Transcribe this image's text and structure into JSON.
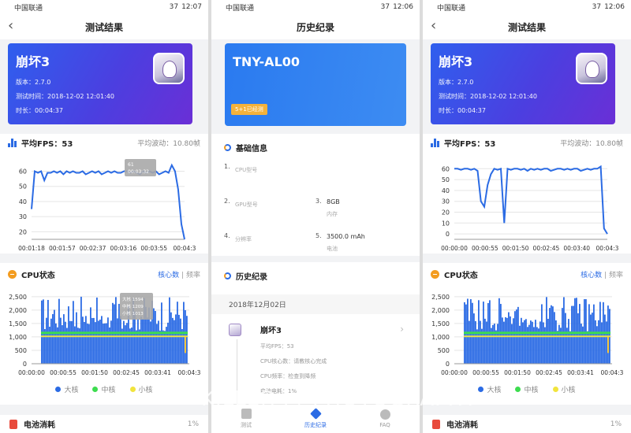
{
  "status": {
    "carrier": "中国联通",
    "battery": "37",
    "time1": "12:07",
    "time2": "12:06",
    "time3": "12:06"
  },
  "p1": {
    "title": "测试结果"
  },
  "p3": {
    "title": "测试结果"
  },
  "game": {
    "name": "崩坏3",
    "version": "版本：2.7.0",
    "test_time": "测试时间：2018-12-02 12:01:40",
    "duration": "时长：00:04:37"
  },
  "fps_section": {
    "label": "平均FPS：53",
    "jitter": "平均波动：10.80帧"
  },
  "cpu_section": {
    "label": "CPU状态",
    "tab_cores": "核心数",
    "tab_sep": "|",
    "tab_freq": "频率"
  },
  "battery_section": {
    "label": "电池消耗",
    "value": "1%"
  },
  "tooltip": {
    "t1": "61",
    "t2": "00:03:32"
  },
  "cpu_tooltip": {
    "l1": "大核 1594",
    "l2": "中核 1209",
    "l3": "小核 1013"
  },
  "p2": {
    "title": "历史纪录",
    "device": "TNY-AL00",
    "tag": "5+1已经测",
    "info_title": "基础信息",
    "info": [
      {
        "n": "1.",
        "val": "",
        "lbl": "CPU型号"
      },
      {
        "n": "",
        "val": "",
        "lbl": ""
      },
      {
        "n": "2.",
        "val": "",
        "lbl": "GPU型号"
      },
      {
        "n": "3.",
        "val": "8GB",
        "lbl": "内存"
      },
      {
        "n": "4.",
        "val": "",
        "lbl": "分辨率"
      },
      {
        "n": "5.",
        "val": "3500.0 mAh",
        "lbl": "电池"
      }
    ],
    "history_title": "历史纪录",
    "history_date": "2018年12月02日",
    "item": {
      "name": "崩坏3",
      "fps": "平均FPS：53",
      "cpu_cores": "CPU核心数：请教核心完成",
      "cpu_freq": "CPU频率：检查到降频",
      "battery": "电池电耗：1%"
    },
    "tabs": [
      "测试",
      "历史纪录",
      "FAQ"
    ]
  },
  "watermark": "KILLER . / PHOTOGRAPHY",
  "colors": {
    "accent": "#2b6be4",
    "big": "#2b6be4",
    "mid": "#3ddc4f",
    "small": "#f1e43d"
  },
  "chart_data": [
    {
      "type": "line",
      "title": "平均FPS：53",
      "x_ticks": [
        "00:01:18",
        "00:01:57",
        "00:02:37",
        "00:03:16",
        "00:03:55",
        "00:04:3"
      ],
      "y_ticks": [
        20,
        30,
        40,
        50,
        60
      ],
      "ylim": [
        15,
        66
      ],
      "series": [
        {
          "values": [
            35,
            60,
            59,
            60,
            54,
            59,
            59,
            60,
            59,
            60,
            58,
            60,
            59,
            60,
            59,
            59,
            60,
            58,
            59,
            60,
            59,
            60,
            58,
            59,
            60,
            59,
            60,
            59,
            59,
            60,
            60,
            59,
            60,
            59,
            58,
            60,
            59,
            60,
            59,
            60,
            58,
            59,
            60,
            59,
            64,
            60,
            48,
            25,
            15
          ]
        }
      ]
    },
    {
      "type": "bar",
      "title": "CPU状态",
      "x_ticks": [
        "00:00:00",
        "00:00:55",
        "00:01:50",
        "00:02:45",
        "00:03:41",
        "00:04:3"
      ],
      "y_ticks": [
        0,
        500,
        1000,
        1500,
        2000,
        2500
      ],
      "ylim": [
        0,
        2700
      ],
      "legend": [
        "大核",
        "中核",
        "小核"
      ]
    },
    {
      "type": "line",
      "title": "平均FPS：53",
      "x_ticks": [
        "00:00:00",
        "00:00:55",
        "00:01:50",
        "00:02:45",
        "00:03:40",
        "00:04:3"
      ],
      "y_ticks": [
        0,
        10,
        20,
        30,
        40,
        50,
        60
      ],
      "ylim": [
        -5,
        66
      ],
      "series": [
        {
          "values": [
            60,
            60,
            59,
            60,
            60,
            59,
            60,
            58,
            30,
            25,
            45,
            55,
            60,
            59,
            60,
            10,
            60,
            59,
            60,
            60,
            59,
            60,
            58,
            60,
            59,
            60,
            59,
            60,
            60,
            58,
            59,
            60,
            60,
            59,
            60,
            59,
            60,
            60,
            58,
            59,
            60,
            59,
            60,
            60,
            62,
            5,
            0
          ]
        }
      ]
    },
    {
      "type": "bar",
      "title": "CPU状态",
      "x_ticks": [
        "00:00:00",
        "00:00:55",
        "00:01:50",
        "00:02:45",
        "00:03:41",
        "00:04:3"
      ],
      "y_ticks": [
        0,
        500,
        1000,
        1500,
        2000,
        2500
      ],
      "ylim": [
        0,
        2700
      ],
      "legend": [
        "大核",
        "中核",
        "小核"
      ]
    }
  ]
}
